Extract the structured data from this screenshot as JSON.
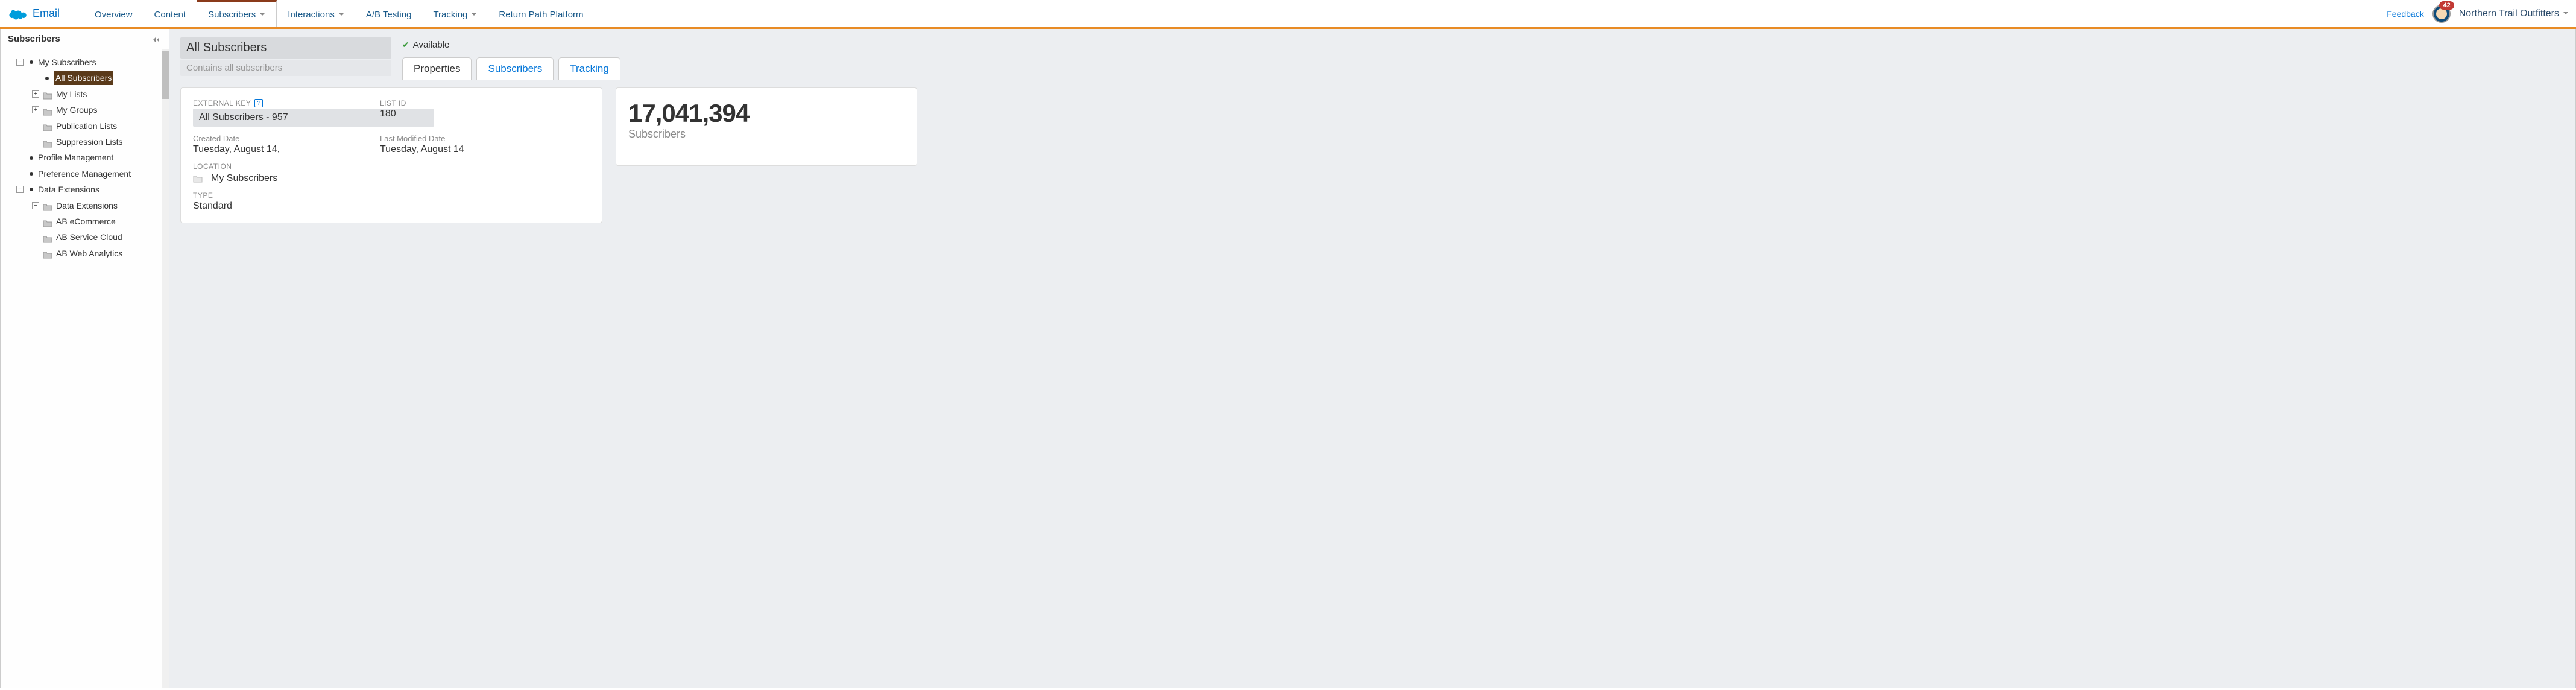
{
  "app_name": "Email",
  "nav": {
    "tabs": [
      {
        "label": "Overview",
        "has_caret": false,
        "active": false
      },
      {
        "label": "Content",
        "has_caret": false,
        "active": false
      },
      {
        "label": "Subscribers",
        "has_caret": true,
        "active": true
      },
      {
        "label": "Interactions",
        "has_caret": true,
        "active": false
      },
      {
        "label": "A/B Testing",
        "has_caret": false,
        "active": false
      },
      {
        "label": "Tracking",
        "has_caret": true,
        "active": false
      },
      {
        "label": "Return Path Platform",
        "has_caret": false,
        "active": false
      }
    ],
    "feedback": "Feedback",
    "badge_count": "42",
    "org_name": "Northern Trail Outfitters"
  },
  "sidebar": {
    "title": "Subscribers",
    "tree": {
      "my_subscribers": "My Subscribers",
      "all_subscribers": "All Subscribers",
      "my_lists": "My Lists",
      "my_groups": "My Groups",
      "publication_lists": "Publication Lists",
      "suppression_lists": "Suppression Lists",
      "profile_management": "Profile Management",
      "preference_management": "Preference Management",
      "data_extensions_root": "Data Extensions",
      "data_extensions_folder": "Data Extensions",
      "ab_ecommerce": "AB eCommerce",
      "ab_service_cloud": "AB Service Cloud",
      "ab_web_analytics": "AB Web Analytics"
    }
  },
  "main": {
    "title": "All Subscribers",
    "subtitle": "Contains all subscribers",
    "available": "Available",
    "tabs": {
      "properties": "Properties",
      "subscribers": "Subscribers",
      "tracking": "Tracking"
    },
    "props": {
      "external_key_label": "EXTERNAL KEY",
      "external_key_value": "All Subscribers - 957",
      "list_id_label": "LIST ID",
      "list_id_value": "180",
      "created_label": "Created Date",
      "created_value": "Tuesday, August 14,",
      "modified_label": "Last Modified Date",
      "modified_value": "Tuesday, August 14",
      "location_label": "LOCATION",
      "location_value": "My Subscribers",
      "type_label": "TYPE",
      "type_value": "Standard"
    },
    "stats": {
      "count": "17,041,394",
      "label": "Subscribers"
    }
  }
}
